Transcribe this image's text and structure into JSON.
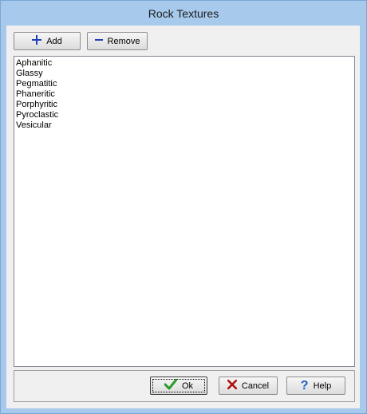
{
  "window": {
    "title": "Rock Textures"
  },
  "toolbar": {
    "add_label": "Add",
    "remove_label": "Remove"
  },
  "list": {
    "items": [
      "Aphanitic",
      "Glassy",
      "Pegmatitic",
      "Phaneritic",
      "Porphyritic",
      "Pyroclastic",
      "Vesicular"
    ]
  },
  "footer": {
    "ok_label": "Ok",
    "cancel_label": "Cancel",
    "help_label": "Help"
  },
  "icons": {
    "add": "plus-icon",
    "remove": "minus-icon",
    "ok": "checkmark-icon",
    "cancel": "x-icon",
    "help": "question-icon"
  },
  "colors": {
    "titlebar": "#a6c9ec",
    "add_icon": "#1f3fb6",
    "ok_icon": "#2a9a2a",
    "cancel_icon": "#b01010",
    "help_icon": "#1f5fc8"
  }
}
